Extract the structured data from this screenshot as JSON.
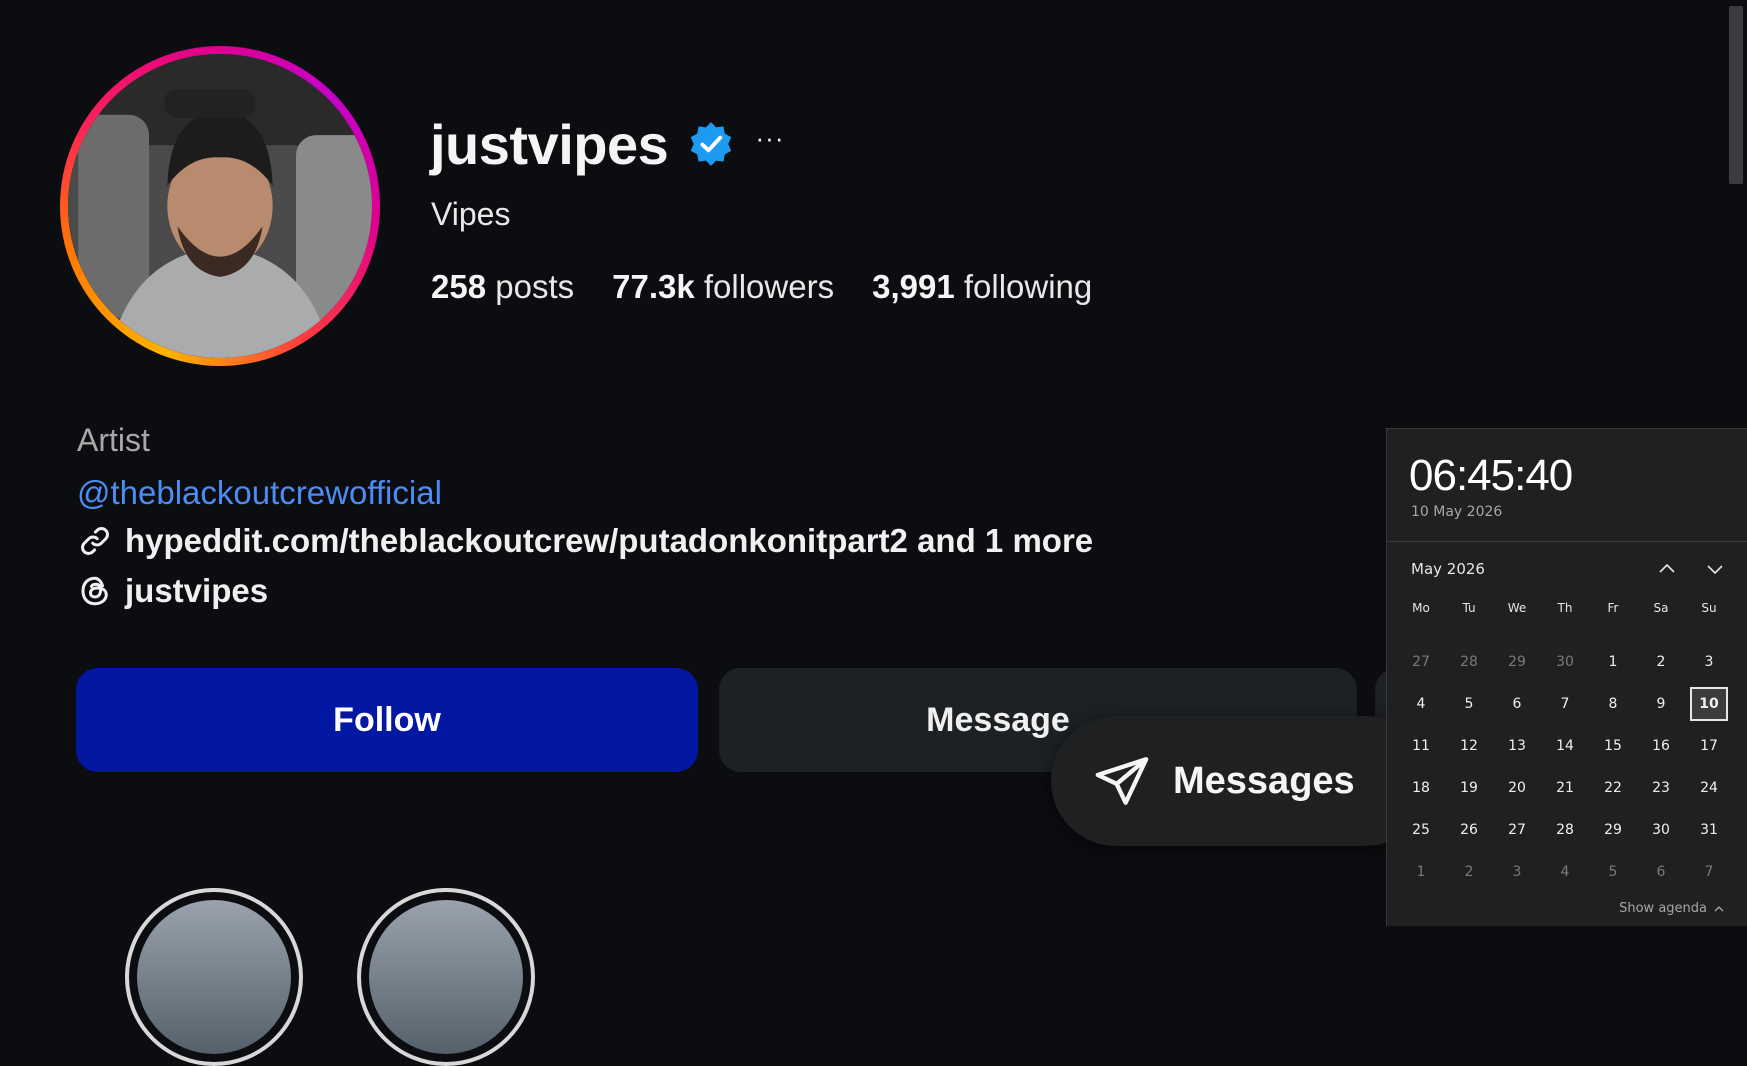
{
  "profile": {
    "username": "justvipes",
    "display_name": "Vipes",
    "more_label": "···",
    "stats": [
      {
        "value": "258",
        "label": "posts"
      },
      {
        "value": "77.3k",
        "label": "followers"
      },
      {
        "value": "3,991",
        "label": "following"
      }
    ],
    "category": "Artist",
    "mention": "@theblackoutcrewofficial",
    "link": "hypeddit.com/theblackoutcrew/putadonkonitpart2 and 1 more",
    "threads_handle": "justvipes"
  },
  "actions": {
    "follow_label": "Follow",
    "message_label": "Message"
  },
  "messages_pill": {
    "label": "Messages"
  },
  "flyout": {
    "time": "06:45:40",
    "date": "10 May 2026",
    "month_title": "May 2026",
    "days_of_week": [
      "Mo",
      "Tu",
      "We",
      "Th",
      "Fr",
      "Sa",
      "Su"
    ],
    "weeks": [
      [
        "27",
        "28",
        "29",
        "30",
        "1",
        "2",
        "3"
      ],
      [
        "4",
        "5",
        "6",
        "7",
        "8",
        "9",
        "10"
      ],
      [
        "11",
        "12",
        "13",
        "14",
        "15",
        "16",
        "17"
      ],
      [
        "18",
        "19",
        "20",
        "21",
        "22",
        "23",
        "24"
      ],
      [
        "25",
        "26",
        "27",
        "28",
        "29",
        "30",
        "31"
      ],
      [
        "1",
        "2",
        "3",
        "4",
        "5",
        "6",
        "7"
      ]
    ],
    "today": "10",
    "show_agenda_label": "Show agenda"
  },
  "colors": {
    "background": "#0b0d10",
    "follow_button": "#0218a3",
    "mention_link": "#4d8cf5",
    "verified_badge": "#1d9bf0",
    "flyout_bg": "#202020"
  }
}
